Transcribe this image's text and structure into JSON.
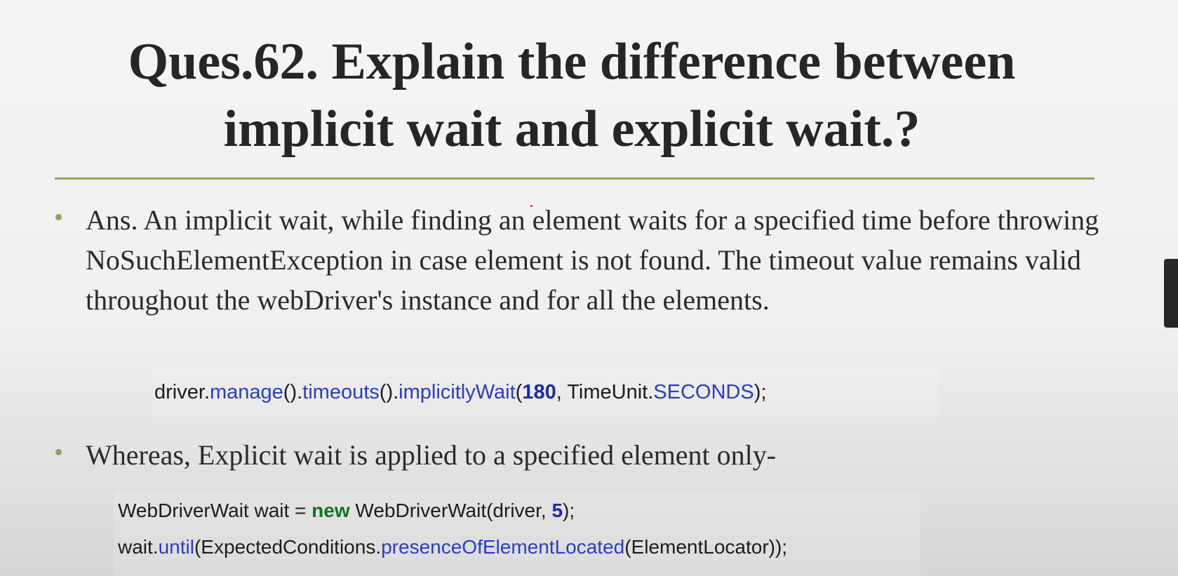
{
  "title": {
    "line1": "Ques.62. Explain the difference between",
    "line2": "implicit wait and explicit wait.?"
  },
  "bullets": {
    "answer": "Ans. An implicit wait, while finding an element waits for a specified time before throwing NoSuchElementException in case element is not found. The timeout value remains valid throughout the webDriver's instance and for all the elements.",
    "whereas": "Whereas, Explicit wait is applied to a specified element only-"
  },
  "code_implicit": {
    "t1": "driver.",
    "t2": "manage",
    "t3": "().",
    "t4": "timeouts",
    "t5": "().",
    "t6": "implicitlyWait",
    "t7": "(",
    "t8": "180",
    "t9": ", TimeUnit.",
    "t10": "SECONDS",
    "t11": ");"
  },
  "code_explicit": {
    "line1": {
      "t1": "WebDriverWait wait = ",
      "t2": "new",
      "t3": " WebDriverWait(driver, ",
      "t4": "5",
      "t5": ");"
    },
    "line2": {
      "t1": "wait.",
      "t2": "until",
      "t3": "(ExpectedConditions.",
      "t4": "presenceOfElementLocated",
      "t5": "(ElementLocator));"
    }
  },
  "colors": {
    "rule": "#a3a352",
    "bullet": "#95a054",
    "method": "#2a3ec4",
    "number": "#1a2aa8",
    "keyword": "#12751c"
  }
}
